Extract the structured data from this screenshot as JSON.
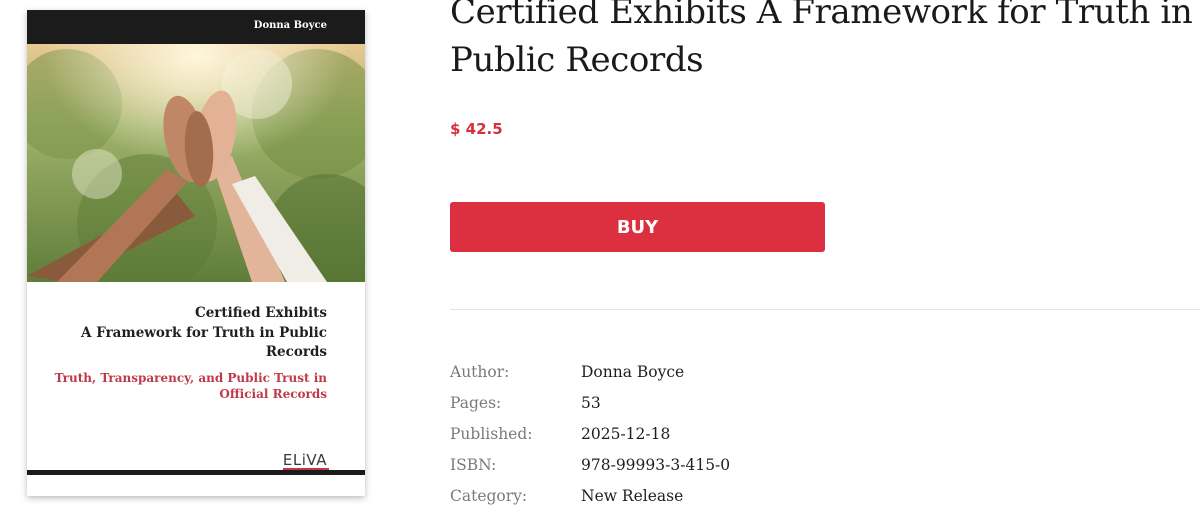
{
  "book": {
    "title": "Certified Exhibits A Framework for Truth in Public Records",
    "title_lines": [
      "Certified Exhibits A Framework for Truth in",
      "Public Records"
    ],
    "price": "$ 42.5",
    "buy_label": "BUY"
  },
  "cover": {
    "author": "Donna Boyce",
    "title_lines": [
      "Certified Exhibits",
      "A Framework for Truth in Public",
      "Records"
    ],
    "subtitle_lines": [
      "Truth, Transparency, and Public Trust in",
      "Official Records"
    ],
    "publisher": "ELiVA",
    "image": "raised-hands-photo"
  },
  "details": [
    {
      "label": "Author:",
      "value": "Donna Boyce"
    },
    {
      "label": "Pages:",
      "value": "53"
    },
    {
      "label": "Published:",
      "value": "2025-12-18"
    },
    {
      "label": "ISBN:",
      "value": "978-99993-3-415-0"
    },
    {
      "label": "Category:",
      "value": "New Release"
    }
  ],
  "colors": {
    "accent": "#dc2f3f",
    "price": "#d5303b",
    "cover_dark": "#1b1b1b",
    "cover_subtitle": "#c0394a"
  }
}
